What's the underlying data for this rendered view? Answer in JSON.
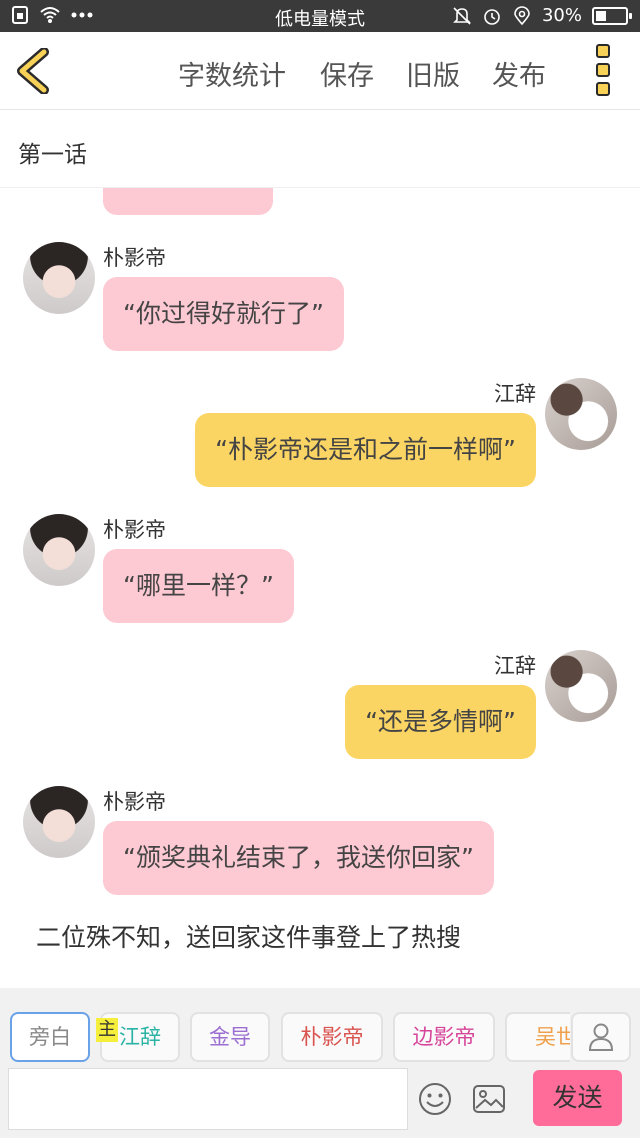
{
  "status_bar": {
    "mode": "低电量模式",
    "battery": "30%",
    "battery_level": 0.3,
    "icons": [
      "sim-icon",
      "wifi-icon",
      "more-dots-icon",
      "mute-icon",
      "alarm-icon",
      "location-icon",
      "battery-icon"
    ]
  },
  "toolbar": {
    "word_count": "字数统计",
    "save": "保存",
    "old_version": "旧版",
    "publish": "发布"
  },
  "chapter": {
    "title": "第一话"
  },
  "messages": [
    {
      "speaker": "",
      "side": "left",
      "text": "",
      "color": "#fdc9d3"
    },
    {
      "speaker": "朴影帝",
      "side": "left",
      "text": "“你过得好就行了”",
      "color": "#fdc9d3"
    },
    {
      "speaker": "江辞",
      "side": "right",
      "text": "“朴影帝还是和之前一样啊”",
      "color": "#fbd563"
    },
    {
      "speaker": "朴影帝",
      "side": "left",
      "text": "“哪里一样？”",
      "color": "#fdc9d3"
    },
    {
      "speaker": "江辞",
      "side": "right",
      "text": "“还是多情啊”",
      "color": "#fbd563"
    },
    {
      "speaker": "朴影帝",
      "side": "left",
      "text": "“颁奖典礼结束了，我送你回家”",
      "color": "#fdc9d3"
    }
  ],
  "narration": "二位殊不知，送回家这件事登上了热搜",
  "roles": [
    {
      "label": "旁白",
      "color": "#888888",
      "selected": true
    },
    {
      "label": "江辞",
      "color": "#2bb3a5",
      "selected": false
    },
    {
      "label": "金导",
      "color": "#9b6fd1",
      "selected": false
    },
    {
      "label": "朴影帝",
      "color": "#d9534f",
      "selected": false
    },
    {
      "label": "边影帝",
      "color": "#d6459a",
      "selected": false
    },
    {
      "label": "吴世",
      "color": "#f0a04b",
      "selected": false
    }
  ],
  "main_badge": "主",
  "input": {
    "value": "",
    "placeholder": ""
  },
  "send": "发送",
  "colors": {
    "accent": "#fbd563",
    "send": "#ff6c9a",
    "pink_bubble": "#fdc9d3",
    "yellow_bubble": "#fbd563"
  }
}
